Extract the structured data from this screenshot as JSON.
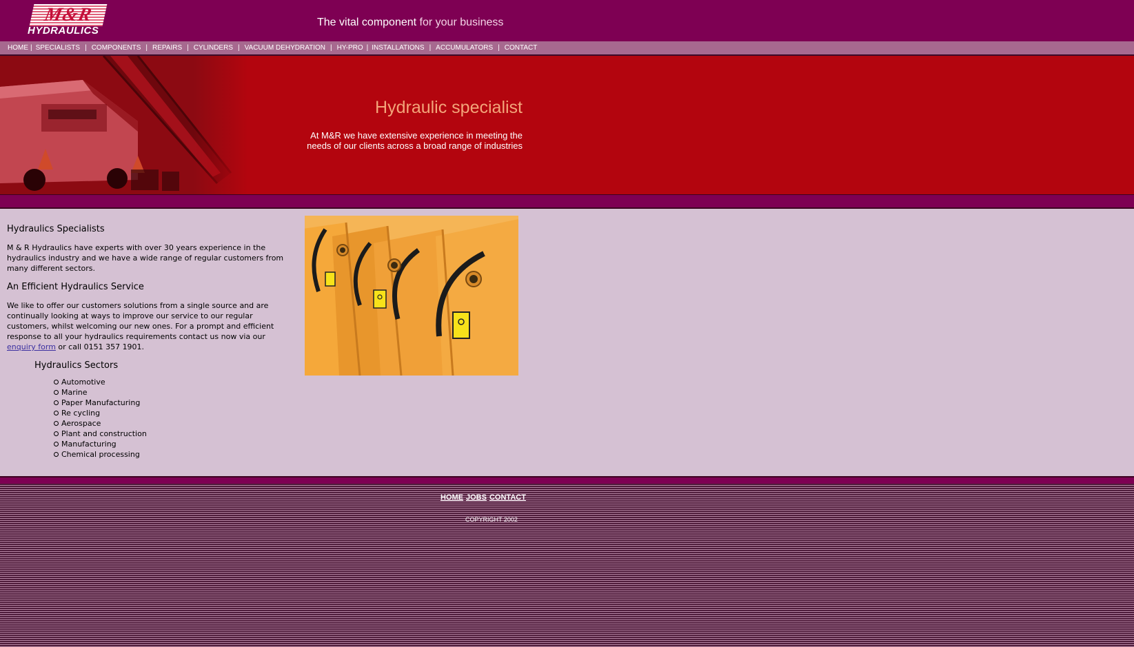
{
  "brand": {
    "logo_top": "M&R",
    "logo_bottom": "HYDRAULICS"
  },
  "header": {
    "tagline_bold": "The vital component",
    "tagline_light": " for your business"
  },
  "nav": {
    "items": [
      "HOME",
      "SPECIALISTS",
      "COMPONENTS",
      "REPAIRS",
      "CYLINDERS",
      "VACUUM DEHYDRATION",
      "HY-PRO",
      "INSTALLATIONS",
      "ACCUMULATORS",
      "CONTACT"
    ],
    "separator": "|"
  },
  "hero": {
    "title": "Hydraulic specialist",
    "text_line1": "At M&R we have extensive experience in meeting the",
    "text_line2": "needs of our clients across a broad range of industries"
  },
  "content": {
    "heading1": "Hydraulics Specialists",
    "para1": "M & R Hydraulics have experts with over 30 years experience in the hydraulics industry and we have a wide range of regular customers from many different sectors.",
    "heading2": "An Efficient Hydraulics Service",
    "para2_before_link": "We like to offer our customers solutions from a single source and are continually looking at ways to improve our service to our regular customers, whilst welcoming our new ones. For a prompt and efficient response to all your hydraulics requirements contact us now via our",
    "enquiry_link": "enquiry form",
    "para2_after_link": " or call 0151 357 1901.",
    "sectors_title": "Hydraulics Sectors",
    "sectors": [
      "Automotive",
      "Marine",
      "Paper Manufacturing",
      "Re cycling",
      "Aerospace",
      "Plant and construction",
      "Manufacturing",
      "Chemical processing"
    ]
  },
  "footer": {
    "links": [
      "HOME",
      "JOBS",
      "CONTACT"
    ],
    "copyright": "COPYRIGHT 2002"
  },
  "colors": {
    "header": "#7e0053",
    "nav": "#a7698f",
    "hero": "#b3050e",
    "content": "#d5c1d3",
    "hero_title": "#f3a57a",
    "link": "#3a2fa0"
  }
}
